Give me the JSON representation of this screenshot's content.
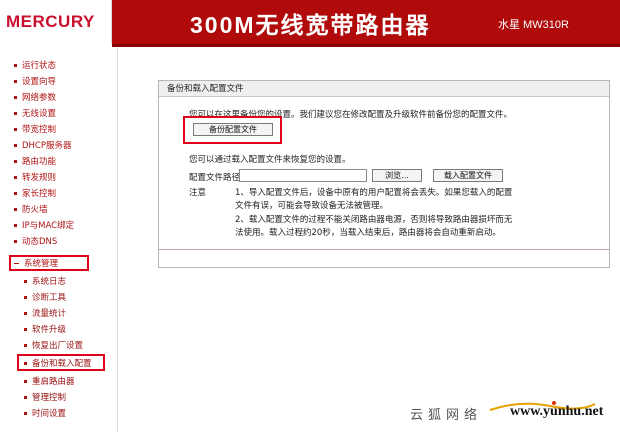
{
  "header": {
    "logo": "MERCURY",
    "title": "300M无线宽带路由器",
    "model": "水星 MW310R",
    "bg_color": "#b00a0a"
  },
  "sidebar": {
    "items": [
      {
        "label": "运行状态"
      },
      {
        "label": "设置向导"
      },
      {
        "label": "网络参数"
      },
      {
        "label": "无线设置"
      },
      {
        "label": "带宽控制"
      },
      {
        "label": "DHCP服务器"
      },
      {
        "label": "路由功能"
      },
      {
        "label": "转发规则"
      },
      {
        "label": "家长控制"
      },
      {
        "label": "防火墙"
      },
      {
        "label": "IP与MAC绑定"
      },
      {
        "label": "动态DNS"
      },
      {
        "label": "系统管理",
        "expanded": true,
        "highlighted": true
      },
      {
        "label": "系统日志",
        "sub": true
      },
      {
        "label": "诊断工具",
        "sub": true
      },
      {
        "label": "流量统计",
        "sub": true
      },
      {
        "label": "软件升级",
        "sub": true
      },
      {
        "label": "恢复出厂设置",
        "sub": true
      },
      {
        "label": "备份和载入配置",
        "sub": true,
        "active": true,
        "highlighted": true
      },
      {
        "label": "重启路由器",
        "sub": true
      },
      {
        "label": "管理控制",
        "sub": true
      },
      {
        "label": "时间设置",
        "sub": true
      }
    ]
  },
  "panel": {
    "title": "备份和载入配置文件",
    "backup_hint": "您可以在这里备份您的设置。我们建议您在修改配置及升级软件前备份您的配置文件。",
    "backup_button": "备份配置文件",
    "restore_hint": "您可以通过载入配置文件来恢复您的设置。",
    "path_label": "配置文件路径",
    "path_value": "",
    "browse_button": "浏览...",
    "load_button": "载入配置文件",
    "note_label": "注意",
    "notes": [
      "1、导入配置文件后，设备中原有的用户配置将会丢失。如果您载入的配置",
      "文件有误，可能会导致设备无法被管理。",
      "2、载入配置文件的过程不能关闭路由器电源，否则将导致路由器损坏而无",
      "法使用。载入过程约20秒，当载入结束后，路由器将会自动重新启动。"
    ]
  },
  "watermark": {
    "text": "云狐网络",
    "url": "www.yunhu.net"
  },
  "colors": {
    "accent": "#b01313",
    "highlight_box": "#e0001b"
  }
}
